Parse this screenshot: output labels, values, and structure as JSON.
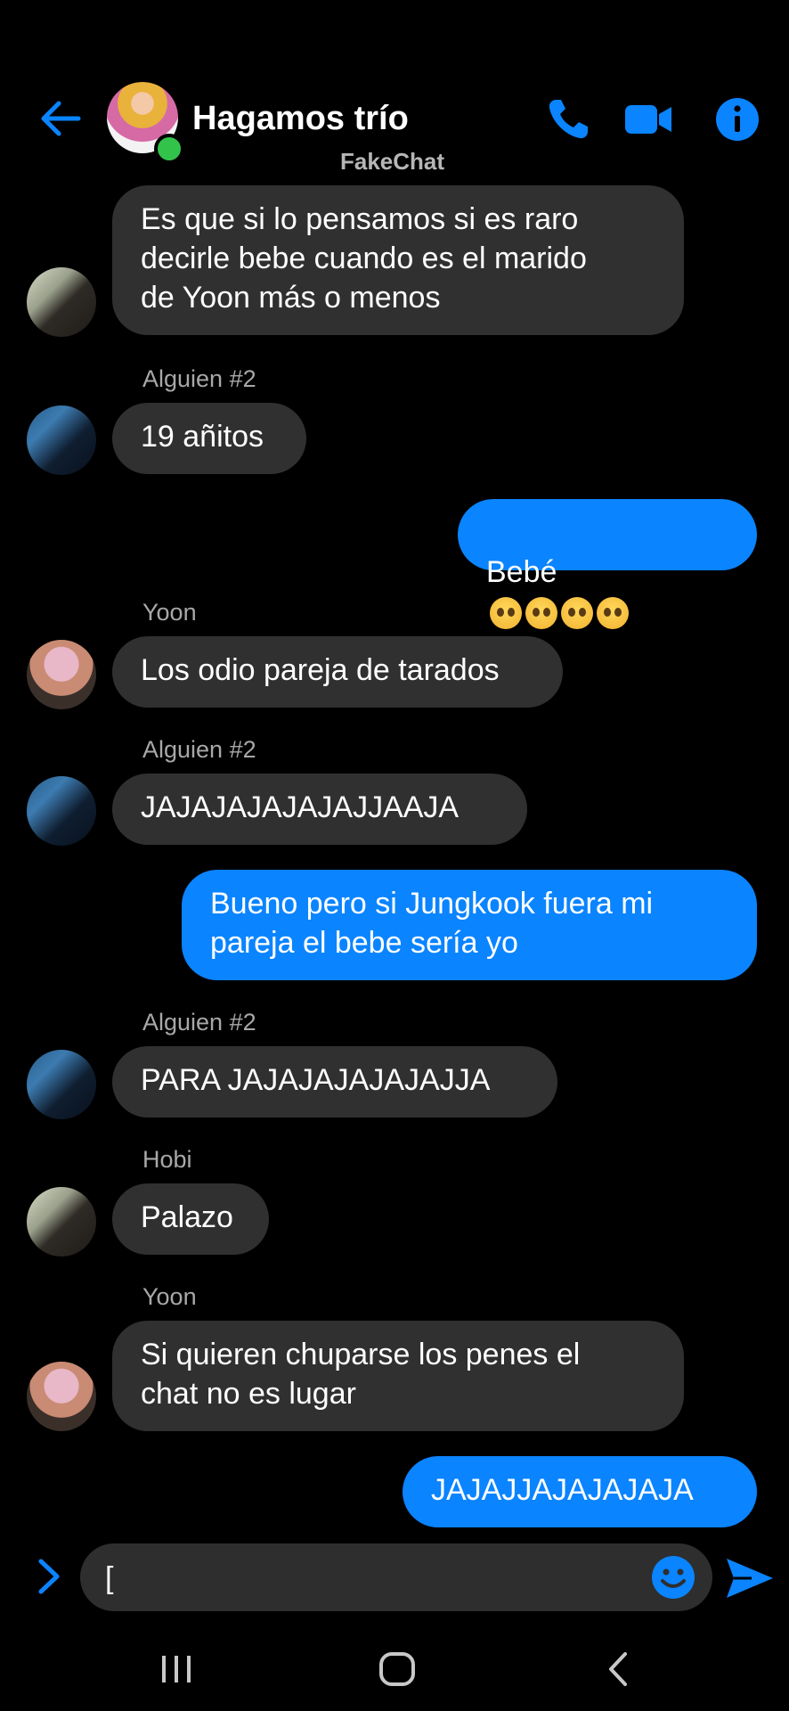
{
  "header": {
    "title": "Hagamos trío",
    "subtitle": "FakeChat",
    "icons": [
      "back-arrow-icon",
      "phone-icon",
      "video-camera-icon",
      "info-icon"
    ],
    "accent_color": "#0a84ff",
    "online_color": "#31c34a"
  },
  "messages": [
    {
      "direction": "in",
      "text": "Es que si lo pensamos si es raro\ndecirle bebe cuando es el marido\nde Yoon más o menos"
    },
    {
      "direction": "in",
      "sender": "Alguien #2",
      "text": "19 añitos"
    },
    {
      "direction": "out",
      "text": "Bebé"
    },
    {
      "direction": "in",
      "sender": "Yoon",
      "text": "Los odio pareja de tarados"
    },
    {
      "direction": "in",
      "sender": "Alguien #2",
      "text": "JAJAJAJAJAJAJJAAJA"
    },
    {
      "direction": "out",
      "text": "Bueno pero si Jungkook fuera mi\npareja el bebe sería yo"
    },
    {
      "direction": "in",
      "sender": "Alguien #2",
      "text": "PARA JAJAJAJAJAJAJJA"
    },
    {
      "direction": "in",
      "sender": "Hobi",
      "text": "Palazo"
    },
    {
      "direction": "in",
      "sender": "Yoon",
      "text": "Si quieren chuparse los penes el\nchat no es lugar"
    },
    {
      "direction": "out",
      "text": "JAJAJJAJAJAJAJA"
    }
  ],
  "composer": {
    "input_value": "["
  },
  "colors": {
    "incoming_bubble": "#303030",
    "outgoing_bubble": "#0a84ff",
    "background": "#000000"
  }
}
